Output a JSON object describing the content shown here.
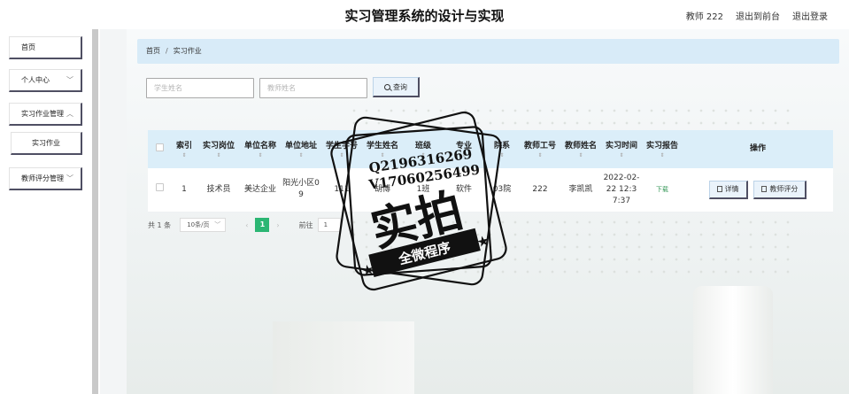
{
  "header": {
    "title": "实习管理系统的设计与实现",
    "user": "教师 222",
    "back_to_front": "退出到前台",
    "logout": "退出登录"
  },
  "sidebar": {
    "items": [
      {
        "label": "首页"
      },
      {
        "label": "个人中心"
      },
      {
        "label": "实习作业管理"
      },
      {
        "label": "实习作业"
      },
      {
        "label": "教师评分管理"
      }
    ]
  },
  "breadcrumb": {
    "home": "首页",
    "sep": "/",
    "current": "实习作业"
  },
  "search": {
    "student_placeholder": "学生姓名",
    "teacher_placeholder": "教师姓名",
    "query_label": "查询"
  },
  "table": {
    "columns": [
      "索引",
      "实习岗位",
      "单位名称",
      "单位地址",
      "学生学号",
      "学生姓名",
      "班级",
      "专业",
      "院系",
      "教师工号",
      "教师姓名",
      "实习时间",
      "实习报告",
      "操作"
    ],
    "rows": [
      {
        "index": "1",
        "position": "技术员",
        "company": "美达企业",
        "address": "阳光小区09",
        "student_no": "111",
        "student_name": "胡博",
        "class_name": "1班",
        "major": "软件",
        "department": "03院",
        "teacher_no": "222",
        "teacher_name": "李凯凯",
        "time": "2022-02-22 12:37:37",
        "report": "下载",
        "detail_label": "详情",
        "grade_label": "教师评分"
      }
    ]
  },
  "pagination": {
    "total": "共 1 条",
    "page_size": "10条/页",
    "prev": "‹",
    "page": "1",
    "next": "›",
    "goto_label": "前往",
    "goto_value": "1"
  },
  "watermark": {
    "line1": "Q2196316269",
    "line2": "V17060256499",
    "main": "实拍",
    "ribbon": "全微程序"
  }
}
